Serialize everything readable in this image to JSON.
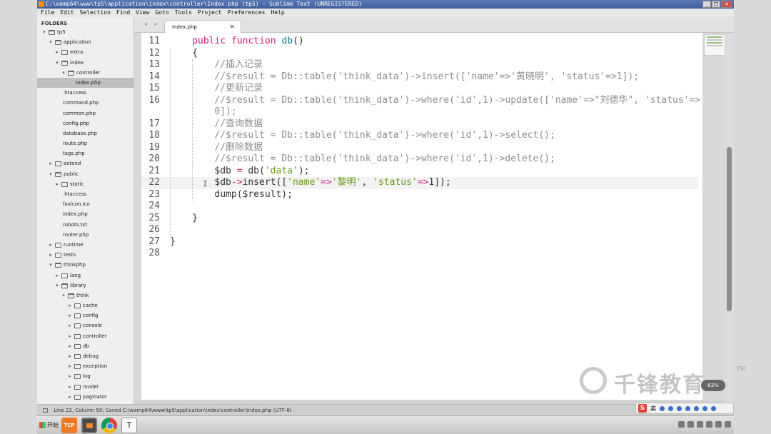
{
  "window": {
    "title": "C:\\wamp64\\www\\tp5\\application\\index\\controller\\Index.php (tp5) - Sublime Text (UNREGISTERED)",
    "buttons": [
      "_",
      "□",
      "×"
    ]
  },
  "menu": [
    "File",
    "Edit",
    "Selection",
    "Find",
    "View",
    "Goto",
    "Tools",
    "Project",
    "Preferences",
    "Help"
  ],
  "sidebar": {
    "title": "FOLDERS",
    "tree": [
      {
        "label": "tp5",
        "depth": 0,
        "type": "folder",
        "open": true
      },
      {
        "label": "application",
        "depth": 1,
        "type": "folder",
        "open": true
      },
      {
        "label": "extra",
        "depth": 2,
        "type": "folder",
        "open": false
      },
      {
        "label": "index",
        "depth": 2,
        "type": "folder",
        "open": true
      },
      {
        "label": "controller",
        "depth": 3,
        "type": "folder",
        "open": true
      },
      {
        "label": "Index.php",
        "depth": 4,
        "type": "file",
        "selected": true
      },
      {
        "label": ".htaccess",
        "depth": 2,
        "type": "file"
      },
      {
        "label": "command.php",
        "depth": 2,
        "type": "file"
      },
      {
        "label": "common.php",
        "depth": 2,
        "type": "file"
      },
      {
        "label": "config.php",
        "depth": 2,
        "type": "file"
      },
      {
        "label": "database.php",
        "depth": 2,
        "type": "file"
      },
      {
        "label": "route.php",
        "depth": 2,
        "type": "file"
      },
      {
        "label": "tags.php",
        "depth": 2,
        "type": "file"
      },
      {
        "label": "extend",
        "depth": 1,
        "type": "folder",
        "open": false
      },
      {
        "label": "public",
        "depth": 1,
        "type": "folder",
        "open": true
      },
      {
        "label": "static",
        "depth": 2,
        "type": "folder",
        "open": false
      },
      {
        "label": ".htaccess",
        "depth": 2,
        "type": "file"
      },
      {
        "label": "favicon.ico",
        "depth": 2,
        "type": "file"
      },
      {
        "label": "index.php",
        "depth": 2,
        "type": "file"
      },
      {
        "label": "robots.txt",
        "depth": 2,
        "type": "file"
      },
      {
        "label": "router.php",
        "depth": 2,
        "type": "file"
      },
      {
        "label": "runtime",
        "depth": 1,
        "type": "folder",
        "open": false
      },
      {
        "label": "tests",
        "depth": 1,
        "type": "folder",
        "open": false
      },
      {
        "label": "thinkphp",
        "depth": 1,
        "type": "folder",
        "open": true
      },
      {
        "label": "lang",
        "depth": 2,
        "type": "folder",
        "open": false
      },
      {
        "label": "library",
        "depth": 2,
        "type": "folder",
        "open": true
      },
      {
        "label": "think",
        "depth": 3,
        "type": "folder",
        "open": true
      },
      {
        "label": "cache",
        "depth": 4,
        "type": "folder",
        "open": false
      },
      {
        "label": "config",
        "depth": 4,
        "type": "folder",
        "open": false
      },
      {
        "label": "console",
        "depth": 4,
        "type": "folder",
        "open": false
      },
      {
        "label": "controller",
        "depth": 4,
        "type": "folder",
        "open": false
      },
      {
        "label": "db",
        "depth": 4,
        "type": "folder",
        "open": false
      },
      {
        "label": "debug",
        "depth": 4,
        "type": "folder",
        "open": false
      },
      {
        "label": "exception",
        "depth": 4,
        "type": "folder",
        "open": false
      },
      {
        "label": "log",
        "depth": 4,
        "type": "folder",
        "open": false
      },
      {
        "label": "model",
        "depth": 4,
        "type": "folder",
        "open": false
      },
      {
        "label": "paginator",
        "depth": 4,
        "type": "folder",
        "open": false
      }
    ]
  },
  "tabs": [
    {
      "label": "Index.php",
      "close": "×"
    }
  ],
  "editor": {
    "current_line": 22,
    "lines": [
      {
        "n": "11",
        "indent": 1,
        "tokens": [
          [
            "k",
            "public "
          ],
          [
            "k",
            "function "
          ],
          [
            "f",
            "db"
          ],
          [
            "p",
            "()"
          ]
        ]
      },
      {
        "n": "12",
        "indent": 1,
        "tokens": [
          [
            "p",
            "{"
          ]
        ]
      },
      {
        "n": "13",
        "indent": 2,
        "tokens": [
          [
            "c",
            "//插入记录"
          ]
        ]
      },
      {
        "n": "14",
        "indent": 2,
        "tokens": [
          [
            "c",
            "//$result = Db::table('think_data')->insert(['name'=>'黄晓明', 'status'=>1]);"
          ]
        ]
      },
      {
        "n": "15",
        "indent": 2,
        "tokens": [
          [
            "c",
            "//更新记录"
          ]
        ]
      },
      {
        "n": "16",
        "indent": 2,
        "tokens": [
          [
            "c",
            "//$result = Db::table('think_data')->where('id',1)->update(['name'=>\"刘德华\", 'status'=>"
          ]
        ]
      },
      {
        "n": "",
        "indent": 2,
        "tokens": [
          [
            "c",
            "0]);"
          ]
        ]
      },
      {
        "n": "17",
        "indent": 2,
        "tokens": [
          [
            "c",
            "//查询数据"
          ]
        ]
      },
      {
        "n": "18",
        "indent": 2,
        "tokens": [
          [
            "c",
            "//$result = Db::table('think_data')->where('id',1)->select();"
          ]
        ]
      },
      {
        "n": "19",
        "indent": 2,
        "tokens": [
          [
            "c",
            "//删除数据"
          ]
        ]
      },
      {
        "n": "20",
        "indent": 2,
        "tokens": [
          [
            "c",
            "//$result = Db::table('think_data')->where('id',1)->delete();"
          ]
        ]
      },
      {
        "n": "21",
        "indent": 2,
        "tokens": [
          [
            "p",
            "$db "
          ],
          [
            "k",
            "="
          ],
          [
            "p",
            " db("
          ],
          [
            "s",
            "'data'"
          ],
          [
            "p",
            ");"
          ]
        ]
      },
      {
        "n": "22",
        "indent": 2,
        "tokens": [
          [
            "p",
            "$db"
          ],
          [
            "k",
            "->"
          ],
          [
            "p",
            "insert(["
          ],
          [
            "s",
            "'name'"
          ],
          [
            "k",
            "=>"
          ],
          [
            "s",
            "'黎明'"
          ],
          [
            "p",
            ", "
          ],
          [
            "s",
            "'status'"
          ],
          [
            "k",
            "=>"
          ],
          [
            "p",
            "1]);"
          ]
        ]
      },
      {
        "n": "23",
        "indent": 2,
        "tokens": [
          [
            "p",
            "dump($result);"
          ]
        ]
      },
      {
        "n": "24",
        "indent": 0,
        "tokens": []
      },
      {
        "n": "25",
        "indent": 1,
        "tokens": [
          [
            "p",
            "}"
          ]
        ]
      },
      {
        "n": "26",
        "indent": 0,
        "tokens": []
      },
      {
        "n": "27",
        "indent": 0,
        "tokens": [
          [
            "p",
            "}"
          ]
        ]
      },
      {
        "n": "28",
        "indent": 0,
        "tokens": []
      }
    ],
    "cursor_glyph": "I"
  },
  "status_bar": {
    "text": "Line 22, Column 50; Saved C:\\wamp64\\www\\tp5\\application\\index\\controller\\Index.php (UTF-8)"
  },
  "ime_toolbar": {
    "logo": "S",
    "mode": "英"
  },
  "taskbar": {
    "start_label": "开始",
    "apps": [
      {
        "name": "totalcmd",
        "label": "TCP"
      },
      {
        "name": "sublime-text",
        "label": ""
      },
      {
        "name": "chrome",
        "label": ""
      },
      {
        "name": "typora",
        "label": "T"
      }
    ]
  },
  "watermark": {
    "text": "千锋教育",
    "tm": "TM",
    "badge": "63%"
  },
  "colors": {
    "keyword": "#d6237e",
    "function": "#0e7c8c",
    "comment": "#8d8d8d",
    "string": "#6a9b16"
  }
}
